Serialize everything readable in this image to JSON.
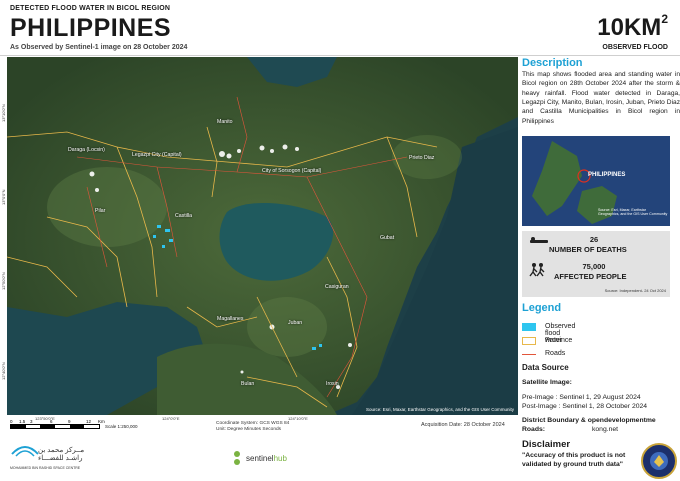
{
  "header": {
    "kicker": "DETECTED FLOOD WATER IN BICOL REGION",
    "title": "PHILIPPINES",
    "subtitle": "As Observed by Sentinel-1 image on 28 October 2024",
    "area_value": "10KM",
    "area_exp": "2",
    "area_label": "OBSERVED FLOOD"
  },
  "map": {
    "credit": "Source: Esri, Maxar, Earthstar Geographics, and the GIS User Community",
    "places": [
      "Manito",
      "Daraga (Locsin)",
      "Legazpi City (Capital)",
      "City of Sorsogon (Capital)",
      "Prieto Diaz",
      "Pilar",
      "Castilla",
      "Gubat",
      "Casiguran",
      "Magallanes",
      "Juban",
      "Bulan",
      "Irosin"
    ],
    "lat_ticks": [
      "13°10'0\"N",
      "13°0'0\"N",
      "12°50'0\"N",
      "12°40'0\"N"
    ],
    "lon_ticks": [
      "123°50'0\"E",
      "124°0'0\"E",
      "124°10'0\"E"
    ]
  },
  "footer": {
    "scale_numbers": [
      "0",
      "1.5",
      "3",
      "6",
      "9",
      "12"
    ],
    "scale_unit": "Km",
    "scale_text": "Scale 1:250,000",
    "coord_system": "Coordinate System: GCS WGS 84",
    "coord_unit": "Unit: Degree Minutes Seconds",
    "acquisition": "Acquisition Date: 28 October 2024",
    "mbrsc_arabic": "مــركز محمد بن راشـد للفضـــاء",
    "mbrsc_english": "MOHAMMED BIN RASHID SPACE CENTRE",
    "sentinel_a": "sentinel",
    "sentinel_b": "hub"
  },
  "panel": {
    "description_heading": "Description",
    "description_text": "This map shows flooded area and standing water in Bicol region on 28th October 2024 after the storm & heavy rainfall. Flood water detected in Daraga, Legazpi City, Manito, Bulan, Irosin, Juban, Prieto Diaz and Castilla Municipalities in Bicol region in Philippines",
    "inset_label": "PHILIPPINES",
    "inset_credit": "Source: Esri, Maxar, Earthstar Geographics, and the GIS User Community",
    "deaths_value": "26",
    "deaths_label": "NUMBER OF DEATHS",
    "affected_value": "75,000",
    "affected_label": "AFFECTED PEOPLE",
    "stats_source": "Source: Independent- 24 Oct 2024",
    "legend_heading": "Legend",
    "legend": [
      {
        "label": "Observed flood water",
        "color": "#2ec5ef"
      },
      {
        "label": "Province",
        "color": "#e8b84a"
      },
      {
        "label": "Roads",
        "color": "#e2553a"
      }
    ],
    "data_source_heading": "Data Source",
    "satellite_heading": "Satellite Image:",
    "pre_image": "Pre-Image   : Sentinel 1, 29 August 2024",
    "post_image": "Post-Image : Sentinel 1, 28 October 2024",
    "boundary_label": "District Boundary & opendevelopmentme",
    "roads_label": "Roads:",
    "boundary_source": "kong.net",
    "disclaimer_heading": "Disclaimer",
    "disclaimer_text": "\"Accuracy of this product is not validated by ground truth data\""
  }
}
